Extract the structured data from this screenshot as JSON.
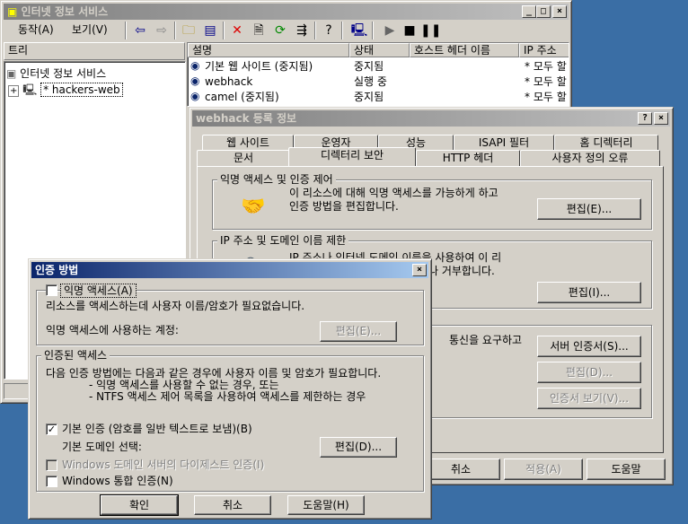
{
  "main": {
    "title": "인터넷 정보 서비스",
    "menu": [
      "동작(A)",
      "보기(V)"
    ],
    "tree_tab": "트리",
    "tree": [
      {
        "label": "인터넷 정보 서비스"
      },
      {
        "label": "* hackers-web"
      }
    ],
    "columns": [
      "설명",
      "상태",
      "호스트 헤더 이름",
      "IP 주소"
    ],
    "rows": [
      {
        "desc": "기본 웹 사이트 (중지됨)",
        "status": "중지됨",
        "host": "",
        "ip": "* 모두 할"
      },
      {
        "desc": "webhack",
        "status": "실행 중",
        "host": "",
        "ip": "* 모두 할"
      },
      {
        "desc": "camel (중지됨)",
        "status": "중지됨",
        "host": "",
        "ip": "* 모두 할"
      }
    ]
  },
  "props": {
    "title": "webhack 등록 정보",
    "tabs_row1": [
      "웹 사이트",
      "운영자",
      "성능",
      "ISAPI 필터",
      "홈 디렉터리"
    ],
    "tabs_row2": [
      "문서",
      "디렉터리 보안",
      "HTTP 헤더",
      "사용자 정의 오류"
    ],
    "anon": {
      "label": "익명 액세스 및 인증 제어",
      "desc1": "이 리소스에 대해 익명 액세스를 가능하게 하고",
      "desc2": "인증 방법을 편집합니다.",
      "edit": "편집(E)..."
    },
    "ip": {
      "label": "IP 주소 및 도메인 이름 제한",
      "desc1": "IP 주소나 인터넷 도메인 이름을 사용하여 이 리",
      "desc2": "소스에 대한 액세스를 허가하거나 거부합니다.",
      "edit": "편집(I)..."
    },
    "secure": {
      "desc1": "통신을 요구하고",
      "server_cert": "서버 인증서(S)...",
      "edit": "편집(D)...",
      "view_cert": "인증서 보기(V)..."
    },
    "buttons": {
      "cancel": "취소",
      "apply": "적용(A)",
      "help": "도움말"
    }
  },
  "auth": {
    "title": "인증 방법",
    "anon_check": "익명 액세스(A)",
    "anon_desc": "리소스를 액세스하는데 사용자 이름/암호가 필요없습니다.",
    "anon_account": "익명 액세스에 사용하는 계정:",
    "anon_edit": "편집(E)...",
    "auth_group": "인증된 액세스",
    "auth_desc": "다음 인증 방법에는 다음과 같은 경우에 사용자 이름 및 암호가 필요합니다.",
    "auth_line1": "- 익명 액세스를 사용할 수 없는 경우, 또는",
    "auth_line2": "- NTFS 액세스 제어 목록을 사용하여 액세스를 제한하는 경우",
    "basic": "기본 인증 (암호를 일반 텍스트로 보냄)(B)",
    "basic_checked": "✓",
    "domain_label": "기본 도메인 선택:",
    "domain_edit": "편집(D)...",
    "digest": "Windows 도메인 서버의 다이제스트 인증(I)",
    "integrated": "Windows 통합 인증(N)",
    "ok": "확인",
    "cancel": "취소",
    "help": "도움말(H)"
  }
}
